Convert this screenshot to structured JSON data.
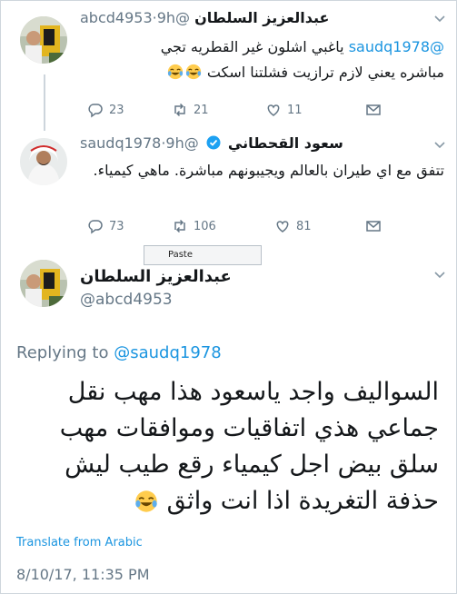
{
  "tweets": [
    {
      "name": "عبدالعزيز السلطان",
      "handle": "@abcd4953",
      "time": "·9h",
      "mention": "@saudq1978",
      "line1": " ياغبي اشلون غير القطريه تجي",
      "line2": "مباشره يعني لازم ترازيت فشلتنا اسكت",
      "replies": "23",
      "retweets": "21",
      "likes": "11",
      "emoji": "tears-of-joy"
    },
    {
      "name": "سعود القحطاني",
      "handle": "@saudq1978",
      "time": "·9h",
      "verified": true,
      "text": "تتفق مع اي طيران بالعالم ويجيبونهم مباشرة. ماهي كيمياء.",
      "replies": "73",
      "retweets": "106",
      "likes": "81"
    }
  ],
  "tooltip": {
    "label": "Paste"
  },
  "main_tweet": {
    "name": "عبدالعزيز السلطان",
    "handle": "@abcd4953",
    "replying_prefix": "Replying to ",
    "replying_to": "@saudq1978",
    "text": "السواليف واجد ياسعود هذا مهب نقل جماعي هذي اتفاقيات وموافقات مهب سلق بيض اجل كيمياء رقع طيب ليش حذفة التغريدة اذا انت واثق",
    "translate_label": "Translate from Arabic",
    "timestamp": "8/10/17, 11:35 PM"
  },
  "colors": {
    "link": "#1b95e0",
    "muted": "#657786",
    "text": "#14171a",
    "border": "#cfd6dc"
  }
}
